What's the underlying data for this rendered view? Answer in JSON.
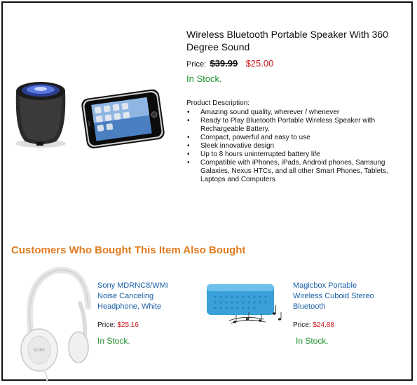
{
  "product": {
    "title": "Wireless Bluetooth Portable Speaker With 360 Degree Sound",
    "price_label": "Price:",
    "old_price": "$39.99",
    "new_price": "$25.00",
    "stock": "In Stock.",
    "description_heading": "Product Description:",
    "description_items": [
      "Amazing sound quality, wherever / whenever",
      "Ready to Play Bluetooth Portable Wireless Speaker with Rechargeable Battery.",
      "Compact, powerful and easy to use",
      "Sleek innovative design",
      "Up to 8 hours uninterrupted battery life",
      "Compatible with iPhones, iPads, Android phones, Samsung Galaxies, Nexus HTCs, and all other Smart Phones, Tablets, Laptops and Computers"
    ]
  },
  "also_bought": {
    "heading": "Customers Who Bought This Item Also Bought",
    "items": [
      {
        "name": "Sony MDRNC8/WMI Noise Canceling Headphone, White",
        "price_label": "Price:",
        "price": "$25.16",
        "stock": "In Stock.",
        "image_brand": "SONY"
      },
      {
        "name": "Magicbox Portable Wireless Cuboid Stereo Bluetooth",
        "price_label": "Price:",
        "price": "$24.88",
        "stock": "In Stock."
      }
    ]
  },
  "colors": {
    "heading_accent": "#e07b1f",
    "link": "#1a5fa6",
    "price_red": "#c8191e",
    "stock_green": "#1f8f2f"
  }
}
